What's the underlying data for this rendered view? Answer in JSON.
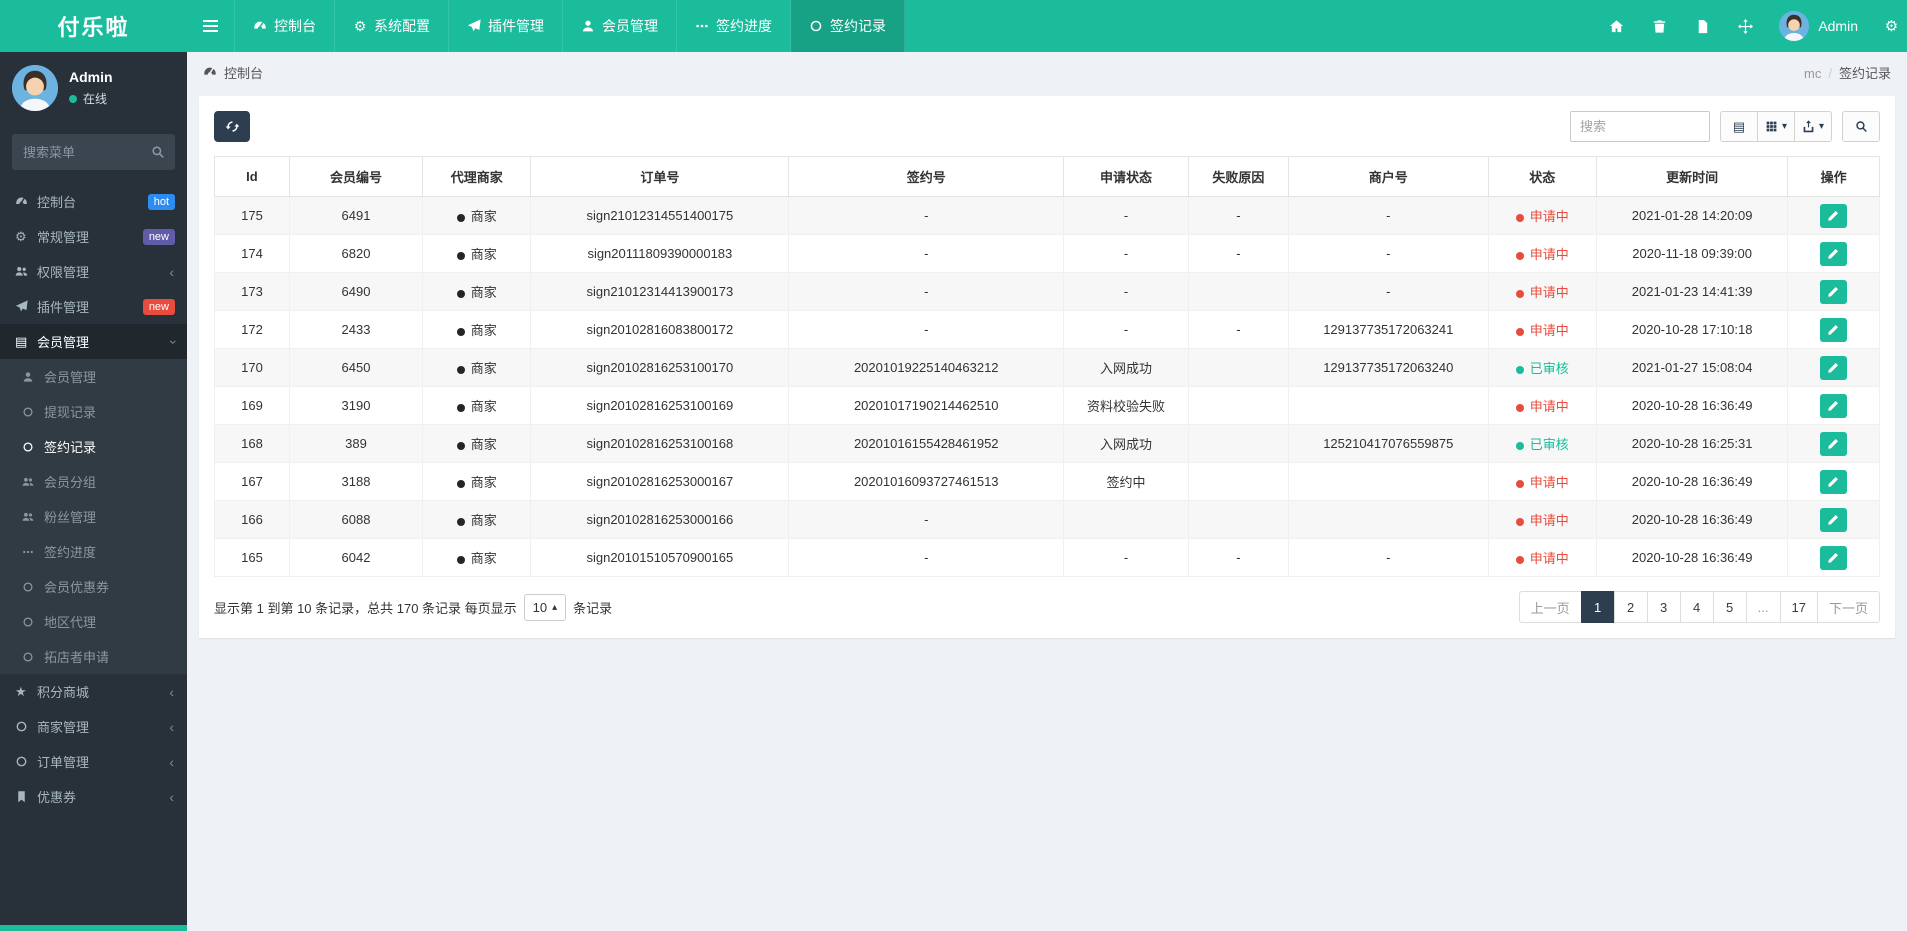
{
  "brand": {
    "name": "付乐啦"
  },
  "navbar": {
    "menu": [
      {
        "label": "控制台",
        "icon": "dashboard",
        "active": false
      },
      {
        "label": "系统配置",
        "icon": "gear",
        "active": false
      },
      {
        "label": "插件管理",
        "icon": "plane",
        "active": false
      },
      {
        "label": "会员管理",
        "icon": "user",
        "active": false
      },
      {
        "label": "签约进度",
        "icon": "ellipsis",
        "active": false
      },
      {
        "label": "签约记录",
        "icon": "circle",
        "active": true
      }
    ],
    "right_icons": [
      "home",
      "trash",
      "file",
      "expand"
    ],
    "user": {
      "name": "Admin"
    },
    "settings_icon": "gears"
  },
  "sidebar": {
    "profile": {
      "name": "Admin",
      "status": "在线"
    },
    "search_placeholder": "搜索菜单",
    "menu": [
      {
        "label": "控制台",
        "icon": "dashboard",
        "badge": {
          "text": "hot",
          "color": "#2d8cf0"
        }
      },
      {
        "label": "常规管理",
        "icon": "gears",
        "badge": {
          "text": "new",
          "color": "#605ca8"
        }
      },
      {
        "label": "权限管理",
        "icon": "users",
        "arrow": "left"
      },
      {
        "label": "插件管理",
        "icon": "plane",
        "badge": {
          "text": "new",
          "color": "#e74c3c"
        }
      },
      {
        "label": "会员管理",
        "icon": "table",
        "arrow": "down",
        "active": true,
        "children": [
          {
            "label": "会员管理",
            "icon": "user"
          },
          {
            "label": "提现记录",
            "icon": "circle"
          },
          {
            "label": "签约记录",
            "icon": "circle",
            "active": true
          },
          {
            "label": "会员分组",
            "icon": "users"
          },
          {
            "label": "粉丝管理",
            "icon": "users"
          },
          {
            "label": "签约进度",
            "icon": "ellipsis"
          },
          {
            "label": "会员优惠券",
            "icon": "circle"
          },
          {
            "label": "地区代理",
            "icon": "circle"
          },
          {
            "label": "拓店者申请",
            "icon": "circle"
          }
        ]
      },
      {
        "label": "积分商城",
        "icon": "star",
        "arrow": "left"
      },
      {
        "label": "商家管理",
        "icon": "circle",
        "arrow": "left"
      },
      {
        "label": "订单管理",
        "icon": "circle",
        "arrow": "left"
      },
      {
        "label": "优惠券",
        "icon": "bookmark",
        "arrow": "left"
      }
    ]
  },
  "breadcrumb": {
    "left": "控制台",
    "left_icon": "dashboard",
    "section": "mc",
    "current": "签约记录"
  },
  "toolbar": {
    "search_placeholder": "搜索",
    "buttons": [
      {
        "icon": "columns",
        "caret": false
      },
      {
        "icon": "grid",
        "caret": true
      },
      {
        "icon": "export",
        "caret": true
      }
    ],
    "find_icon": "search"
  },
  "table": {
    "columns": [
      "Id",
      "会员编号",
      "代理商家",
      "订单号",
      "签约号",
      "申请状态",
      "失败原因",
      "商户号",
      "状态",
      "更新时间",
      "操作"
    ],
    "status_labels": {
      "applying": "申请中",
      "approved": "已审核"
    },
    "status_colors": {
      "applying": "#e74c3c",
      "approved": "#1abc9c"
    },
    "rows": [
      {
        "id": "175",
        "member": "6491",
        "agent": "商家",
        "order": "sign21012314551400175",
        "sign": "-",
        "apply": "-",
        "fail": "-",
        "merchant": "-",
        "status": "applying",
        "updated": "2021-01-28 14:20:09"
      },
      {
        "id": "174",
        "member": "6820",
        "agent": "商家",
        "order": "sign20111809390000183",
        "sign": "-",
        "apply": "-",
        "fail": "-",
        "merchant": "-",
        "status": "applying",
        "updated": "2020-11-18 09:39:00"
      },
      {
        "id": "173",
        "member": "6490",
        "agent": "商家",
        "order": "sign21012314413900173",
        "sign": "-",
        "apply": "-",
        "fail": "",
        "merchant": "-",
        "status": "applying",
        "updated": "2021-01-23 14:41:39"
      },
      {
        "id": "172",
        "member": "2433",
        "agent": "商家",
        "order": "sign20102816083800172",
        "sign": "-",
        "apply": "-",
        "fail": "-",
        "merchant": "129137735172063241",
        "status": "applying",
        "updated": "2020-10-28 17:10:18"
      },
      {
        "id": "170",
        "member": "6450",
        "agent": "商家",
        "order": "sign20102816253100170",
        "sign": "20201019225140463212",
        "apply": "入网成功",
        "fail": "",
        "merchant": "129137735172063240",
        "status": "approved",
        "updated": "2021-01-27 15:08:04"
      },
      {
        "id": "169",
        "member": "3190",
        "agent": "商家",
        "order": "sign20102816253100169",
        "sign": "20201017190214462510",
        "apply": "资料校验失败",
        "fail": "",
        "merchant": "",
        "status": "applying",
        "updated": "2020-10-28 16:36:49"
      },
      {
        "id": "168",
        "member": "389",
        "agent": "商家",
        "order": "sign20102816253100168",
        "sign": "20201016155428461952",
        "apply": "入网成功",
        "fail": "",
        "merchant": "125210417076559875",
        "status": "approved",
        "updated": "2020-10-28 16:25:31"
      },
      {
        "id": "167",
        "member": "3188",
        "agent": "商家",
        "order": "sign20102816253000167",
        "sign": "20201016093727461513",
        "apply": "签约中",
        "fail": "",
        "merchant": "",
        "status": "applying",
        "updated": "2020-10-28 16:36:49"
      },
      {
        "id": "166",
        "member": "6088",
        "agent": "商家",
        "order": "sign20102816253000166",
        "sign": "-",
        "apply": "",
        "fail": "",
        "merchant": "",
        "status": "applying",
        "updated": "2020-10-28 16:36:49"
      },
      {
        "id": "165",
        "member": "6042",
        "agent": "商家",
        "order": "sign20101510570900165",
        "sign": "-",
        "apply": "-",
        "fail": "-",
        "merchant": "-",
        "status": "applying",
        "updated": "2020-10-28 16:36:49"
      }
    ]
  },
  "footer": {
    "summary_prefix": "显示第 1 到第 10 条记录，总共 170 条记录 每页显示",
    "page_size": "10",
    "summary_suffix": "条记录",
    "pagination": [
      "上一页",
      "1",
      "2",
      "3",
      "4",
      "5",
      "...",
      "17",
      "下一页"
    ],
    "active_page": "1"
  }
}
